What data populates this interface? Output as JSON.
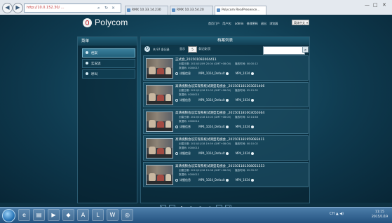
{
  "browser": {
    "address_url": "http://10.0.152.30/ ...",
    "tabs": [
      {
        "label": "RMX 10.33.14.230"
      },
      {
        "label": "RMX 10.33.54.20"
      },
      {
        "label": "Polycom RealPresence..."
      }
    ],
    "controls": [
      "—",
      "□",
      "✕"
    ]
  },
  "header": {
    "logo_text": "Polycom",
    "nav": {
      "home": "首页门户",
      "user_label": "用户名:",
      "user": "admin",
      "change_password": "修改密码",
      "logout": "退出",
      "browser_label": "浏览器",
      "language": "简体中文"
    }
  },
  "sidebar": {
    "title": "菜单",
    "items": [
      {
        "label": "档案",
        "selected": true
      },
      {
        "label": "实况流",
        "selected": false
      },
      {
        "label": "呼叫",
        "selected": false
      }
    ]
  },
  "main": {
    "title": "档案列表",
    "toolbar": {
      "refresh_icon": "refresh-icon",
      "count_text": "共 97 条记录",
      "page_size_label": "显示",
      "page_size_value": "5",
      "page_size_suffix": "条记录/页",
      "search_placeholder": "",
      "search_icon": "search-icon"
    },
    "records": [
      {
        "title": "正式会_201501092004411",
        "created_label": "创建日期:",
        "created": "2015/01/09 20:04 (GMT+08:00)",
        "duration_label": "播放时间:",
        "duration": "00:00:12",
        "size_label": "数据码:",
        "size": "0000017",
        "details": "详细信息",
        "format1": "MP4_1024_Default",
        "format2": "MP4_1024"
      },
      {
        "title": "高清视频会议实现系统试测型电视会 _201501181203021406",
        "created_label": "创建日期:",
        "created": "2015/01/18 12:03 (GMT+08:00)",
        "duration_label": "播放时间:",
        "duration": "02:15:32",
        "size_label": "数据码:",
        "size": "0000015",
        "details": "详细信息",
        "format1": "MP4_1024_Default",
        "format2": "MP4_1024"
      },
      {
        "title": "高清视频会议实现系统试测型电视会 _201501181003050364",
        "created_label": "创建日期:",
        "created": "2015/01/18 10:03 (GMT+08:00)",
        "duration_label": "播放时间:",
        "duration": "02:14:48",
        "size_label": "数据码:",
        "size": "0000014",
        "details": "详细信息",
        "format1": "MP4_1024_Default",
        "format2": "MP4_1024"
      },
      {
        "title": "高清视频会议实现系统试测型电视会 _201501181959083411",
        "created_label": "创建日期:",
        "created": "2015/01/18 19:59 (GMT+08:00)",
        "duration_label": "播放时间:",
        "duration": "00:10:02",
        "size_label": "数据码:",
        "size": "0000013",
        "details": "详细信息",
        "format1": "MP4_1024_Default",
        "format2": "MP4_1024"
      },
      {
        "title": "高清视频会议实现系统试测型电视会 _201501181508051553",
        "created_label": "创建日期:",
        "created": "2015/01/18 15:08 (GMT+08:00)",
        "duration_label": "播放时间:",
        "duration": "02:35:37",
        "size_label": "数据码:",
        "size": "0000012",
        "details": "详细信息",
        "format1": "MP4_1024_Default",
        "format2": "MP4_1024"
      }
    ]
  },
  "pager": {
    "first": "|◀",
    "prev": "◀",
    "pages": [
      "1",
      "2",
      "3",
      "4"
    ],
    "current": "1",
    "next": "▶",
    "last": "▶|"
  },
  "taskbar": {
    "tray_text": "CH ▲ ◀)",
    "time": "11:15",
    "date": "2015/1/19"
  }
}
